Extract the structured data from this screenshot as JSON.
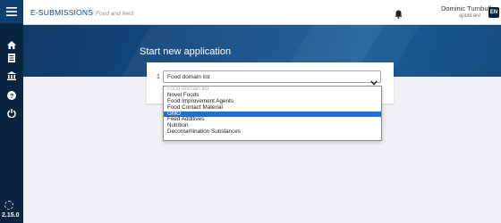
{
  "sidebar": {
    "icons": [
      "menu-icon",
      "home-icon",
      "document-icon",
      "bank-icon",
      "help-icon",
      "power-icon"
    ],
    "version": "2.15.0"
  },
  "header": {
    "app_name": "E-SUBMISSIONS",
    "app_sub": "Food and feed",
    "user_name": "Dominic Turnbull",
    "user_role": "applicant",
    "language": "EN"
  },
  "main": {
    "title": "Start new application",
    "step_number": "1",
    "select_value": "Food domain list",
    "options": [
      {
        "label": "Food domain list",
        "state": "disabled"
      },
      {
        "label": "Novel Foods",
        "state": "normal"
      },
      {
        "label": "Food Improvement Agents",
        "state": "normal"
      },
      {
        "label": "Food Contact Material",
        "state": "normal"
      },
      {
        "label": "GMO",
        "state": "selected"
      },
      {
        "label": "Feed Additives",
        "state": "normal"
      },
      {
        "label": "Nutrition",
        "state": "normal"
      },
      {
        "label": "Decontamination Substances",
        "state": "normal"
      }
    ]
  },
  "colors": {
    "sidebar": "#0a2540",
    "banner": "#154d86",
    "selected_option": "#1e6fd9"
  }
}
